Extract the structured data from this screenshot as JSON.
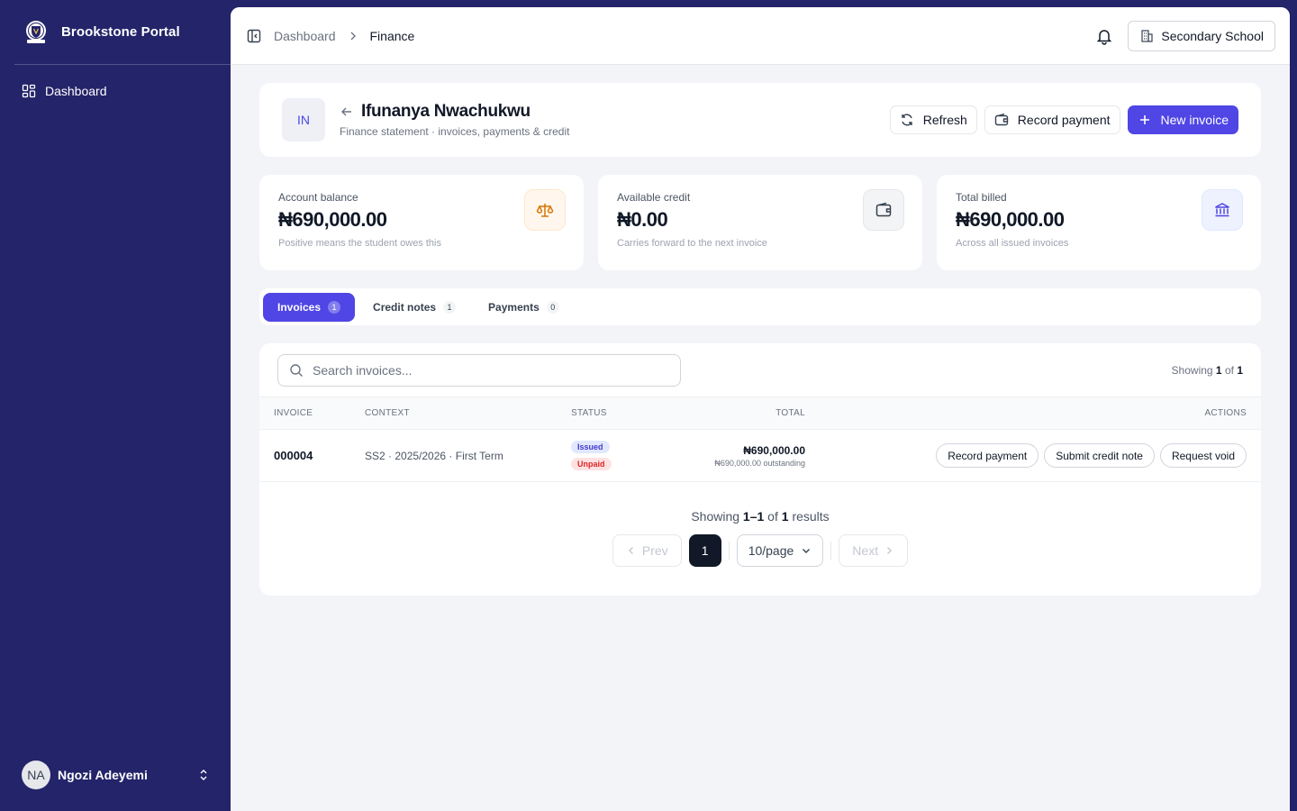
{
  "sidebar": {
    "brand": "Brookstone Portal",
    "nav": [
      {
        "label": "Dashboard",
        "icon": "layout-grid-icon"
      }
    ],
    "user": {
      "initials": "NA",
      "name": "Ngozi Adeyemi"
    }
  },
  "topbar": {
    "breadcrumb": [
      "Dashboard",
      "Finance"
    ],
    "school": "Secondary School"
  },
  "student": {
    "initials": "IN",
    "name": "Ifunanya Nwachukwu",
    "subtitle": "Finance statement · invoices, payments & credit"
  },
  "header_actions": {
    "refresh": "Refresh",
    "record_payment": "Record payment",
    "new_invoice": "New invoice"
  },
  "stats": [
    {
      "label": "Account balance",
      "value": "₦690,000.00",
      "note": "Positive means the student owes this",
      "icon": "scale-icon",
      "accent": "#d97706"
    },
    {
      "label": "Available credit",
      "value": "₦0.00",
      "note": "Carries forward to the next invoice",
      "icon": "wallet-icon",
      "accent": "#374151"
    },
    {
      "label": "Total billed",
      "value": "₦690,000.00",
      "note": "Across all issued invoices",
      "icon": "bank-icon",
      "accent": "#4f46e5"
    }
  ],
  "tabs": [
    {
      "label": "Invoices",
      "count": "1",
      "active": true
    },
    {
      "label": "Credit notes",
      "count": "1",
      "active": false
    },
    {
      "label": "Payments",
      "count": "0",
      "active": false
    }
  ],
  "table": {
    "search_placeholder": "Search invoices...",
    "showing_prefix": "Showing",
    "showing_from": "1",
    "showing_of": "of",
    "showing_total": "1",
    "columns": [
      "INVOICE",
      "CONTEXT",
      "STATUS",
      "TOTAL",
      "ACTIONS"
    ],
    "rows": [
      {
        "invoice": "000004",
        "context": "SS2 · 2025/2026 · First Term",
        "status": [
          "Issued",
          "Unpaid"
        ],
        "total": "₦690,000.00",
        "outstanding": "₦690,000.00 outstanding",
        "actions": [
          "Record payment",
          "Submit credit note",
          "Request void"
        ]
      }
    ]
  },
  "pagination": {
    "summary_prefix": "Showing",
    "range": "1–1",
    "of": "of",
    "total": "1",
    "results": "results",
    "prev": "Prev",
    "page": "1",
    "page_size": "10/page",
    "next": "Next"
  },
  "colors": {
    "accent": "#4f46e5",
    "sidebar": "#24246a"
  }
}
